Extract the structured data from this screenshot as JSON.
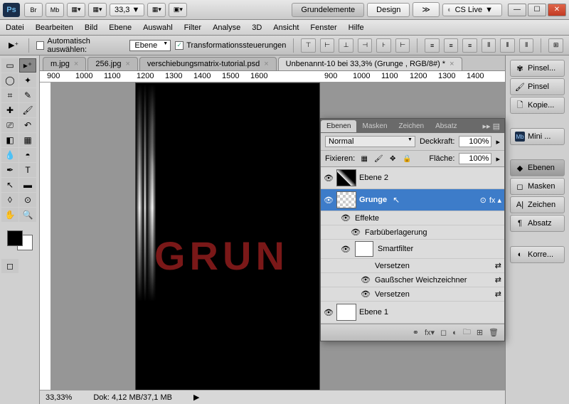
{
  "titlebar": {
    "zoom": "33,3",
    "workspace_labels": [
      "Grundelemente",
      "Design"
    ],
    "cslive": "CS Live"
  },
  "menubar": [
    "Datei",
    "Bearbeiten",
    "Bild",
    "Ebene",
    "Auswahl",
    "Filter",
    "Analyse",
    "3D",
    "Ansicht",
    "Fenster",
    "Hilfe"
  ],
  "optionbar": {
    "auto_check_label": "Automatisch auswählen:",
    "auto_target": "Ebene",
    "transform_label": "Transformationssteuerungen"
  },
  "doc_tabs": [
    {
      "label": "m.jpg",
      "active": false
    },
    {
      "label": "256.jpg",
      "active": false
    },
    {
      "label": "verschiebungsmatrix-tutorial.psd",
      "active": false
    },
    {
      "label": "Unbenannt-10 bei 33,3% (Grunge  , RGB/8#) *",
      "active": true
    }
  ],
  "ruler_marks": [
    "900",
    "1000",
    "1100",
    "1200",
    "1300",
    "1400",
    "1500",
    "1600",
    "900",
    "1000",
    "1100",
    "1200",
    "1300",
    "1400"
  ],
  "canvas_text": "GRUN",
  "statusbar": {
    "zoom": "33,33%",
    "doc": "Dok: 4,12 MB/37,1 MB"
  },
  "dock": [
    {
      "icon": "✾",
      "label": "Pinsel..."
    },
    {
      "icon": "🖌",
      "label": "Pinsel"
    },
    {
      "icon": "🗋",
      "label": "Kopie..."
    },
    {
      "icon": "Mb",
      "label": "Mini ..."
    },
    {
      "icon": "◆",
      "label": "Ebenen",
      "active": true
    },
    {
      "icon": "◻",
      "label": "Masken"
    },
    {
      "icon": "A|",
      "label": "Zeichen"
    },
    {
      "icon": "¶",
      "label": "Absatz"
    },
    {
      "icon": "◐",
      "label": "Korre..."
    }
  ],
  "layers_panel": {
    "tabs": [
      "Ebenen",
      "Masken",
      "Zeichen",
      "Absatz"
    ],
    "blend_label": "Normal",
    "deckkraft_label": "Deckkraft:",
    "deckkraft_val": "100%",
    "fixieren_label": "Fixieren:",
    "flaeche_label": "Fläche:",
    "flaeche_val": "100%",
    "layers": [
      {
        "name": "Ebene 2"
      },
      {
        "name": "Grunge",
        "selected": true
      },
      {
        "name": "Effekte",
        "indent": 1,
        "eye": true
      },
      {
        "name": "Farbüberlagerung",
        "indent": 2,
        "eye": true
      },
      {
        "name": "Smartfilter",
        "indent": 1,
        "eye": true,
        "thumb": true
      },
      {
        "name": "Versetzen",
        "indent": 2
      },
      {
        "name": "Gaußscher Weichzeichner",
        "indent": 2,
        "eye": true
      },
      {
        "name": "Versetzen",
        "indent": 2,
        "eye": true
      },
      {
        "name": "Ebene 1"
      }
    ]
  }
}
